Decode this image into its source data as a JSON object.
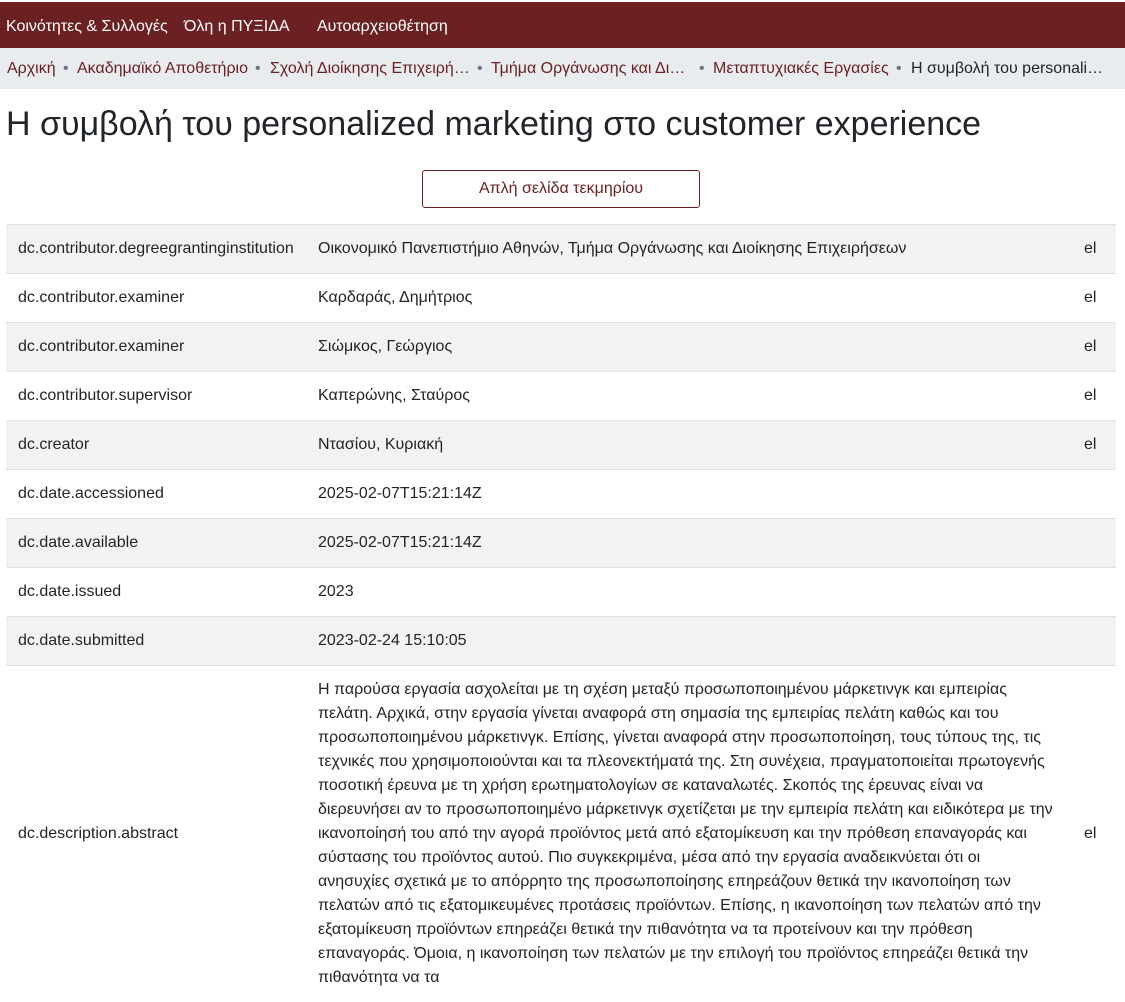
{
  "nav": {
    "communities": "Κοινότητες & Συλλογές",
    "all": "Όλη η ΠΥΞΙΔΑ",
    "self_archive": "Αυτοαρχειοθέτηση"
  },
  "breadcrumb": [
    "Αρχική",
    "Ακαδημαϊκό Αποθετήριο",
    "Σχολή Διοίκησης Επιχειρή…",
    "Τμήμα Οργάνωσης και Δι…",
    "Μεταπτυχιακές Εργασίες",
    "Η συμβολή του personali…"
  ],
  "page_title": "Η συμβολή του personalized marketing στο customer experience",
  "simple_page_button": "Απλή σελίδα τεκμηρίου",
  "rows": [
    {
      "key": "dc.contributor.degreegrantinginstitution",
      "value": "Οικονομικό Πανεπιστήμιο Αθηνών, Τμήμα Οργάνωσης και Διοίκησης Επιχειρήσεων",
      "lang": "el"
    },
    {
      "key": "dc.contributor.examiner",
      "value": "Καρδαράς, Δημήτριος",
      "lang": "el"
    },
    {
      "key": "dc.contributor.examiner",
      "value": "Σιώμκος, Γεώργιος",
      "lang": "el"
    },
    {
      "key": "dc.contributor.supervisor",
      "value": "Καπερώνης, Σταύρος",
      "lang": "el"
    },
    {
      "key": "dc.creator",
      "value": "Ντασίου, Κυριακή",
      "lang": "el"
    },
    {
      "key": "dc.date.accessioned",
      "value": "2025-02-07T15:21:14Z",
      "lang": ""
    },
    {
      "key": "dc.date.available",
      "value": "2025-02-07T15:21:14Z",
      "lang": ""
    },
    {
      "key": "dc.date.issued",
      "value": "2023",
      "lang": ""
    },
    {
      "key": "dc.date.submitted",
      "value": "2023-02-24 15:10:05",
      "lang": ""
    },
    {
      "key": "dc.description.abstract",
      "value": "Η παρούσα εργασία ασχολείται με τη σχέση μεταξύ προσωποποιημένου μάρκετινγκ και εμπειρίας πελάτη. Αρχικά, στην εργασία γίνεται αναφορά στη σημασία της εμπειρίας πελάτη καθώς και του προσωποποιημένου μάρκετινγκ. Επίσης, γίνεται αναφορά στην προσωποποίηση, τους τύπους της, τις τεχνικές που χρησιμοποιούνται και τα πλεονεκτήματά της. Στη συνέχεια, πραγματοποιείται πρωτογενής ποσοτική έρευνα με τη χρήση ερωτηματολογίων σε καταναλωτές. Σκοπός της έρευνας είναι να διερευνήσει αν το προσωποποιημένο μάρκετινγκ σχετίζεται με την εμπειρία πελάτη και ειδικότερα με την ικανοποίησή του από την αγορά προϊόντος μετά από εξατομίκευση και την πρόθεση επαναγοράς και σύστασης του προϊόντος αυτού. Πιο συγκεκριμένα, μέσα από την εργασία αναδεικνύεται ότι οι ανησυχίες σχετικά με το απόρρητο της προσωποποίησης επηρεάζουν θετικά την ικανοποίηση των πελατών από τις εξατομικευμένες προτάσεις προϊόντων. Επίσης, η ικανοποίηση των πελατών από την εξατομίκευση προϊόντων επηρεάζει θετικά την πιθανότητα να τα προτείνουν και την πρόθεση επαναγοράς. Όμοια, η ικανοποίηση των πελατών με την επιλογή του προϊόντος επηρεάζει θετικά την πιθανότητα να τα",
      "lang": "el"
    }
  ],
  "colors": {
    "brand": "#6b2022",
    "stripe": "#f2f2f2",
    "breadcrumb_bg": "#e9ecef"
  }
}
